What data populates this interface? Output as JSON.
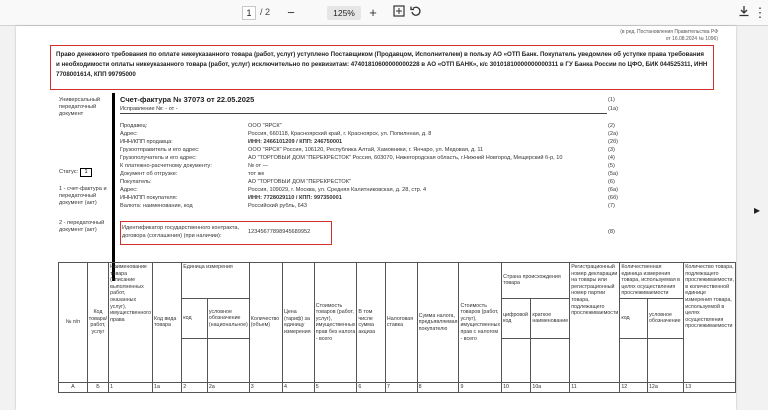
{
  "viewer": {
    "page_current": "1",
    "page_separator": "/",
    "page_total": "2",
    "zoom": "125%",
    "icons": [
      "minus-icon",
      "plus-icon",
      "fit-page-icon",
      "rotate-icon",
      "download-icon",
      "more-icon"
    ]
  },
  "doc": {
    "top_note": [
      "(в ред. Постановления Правительства РФ",
      "от 16.08.2024 № 1096)"
    ],
    "notice": "Право денежного требования по оплате никеуказанного товара (работ, услуг) уступлено Поставщиком (Продавцом, Исполнителем) в пользу АО «ОТП Банк. Покупатель уведомлен об уступке права требования и необходимости оплаты никеуказанного товара (работ, услуг) исключительно по реквизитам: 47401810600000000228 в АО «ОТП БАНК», к/с 30101810000000000311 в ГУ Банка России по ЦФО, БИК 044525311, ИНН 7708001614, КПП 99795000",
    "left_caption_top": "Универсальный передаточный документ",
    "status_label": "Статус:",
    "status_value": "1",
    "left_caption_status1": "1 - счет-фактура и передаточный документ (акт)",
    "left_caption_status2": "2 - передаточный документ (акт)",
    "invoice_title": "Счет-фактура № 37073  от 22.05.2025",
    "invoice_title_num": "(1)",
    "invoice_fix": "Исправление №: - от -",
    "invoice_fix_num": "(1а)",
    "fields": [
      {
        "label": "Продавец:",
        "value": "ООО \"ЯРСК\"",
        "num": "(2)"
      },
      {
        "label": "Адрес:",
        "value": "Россия, 660118, Красноярский край, г. Красноярск, ул. Попилнная, д. 8",
        "num": "(2а)"
      },
      {
        "label": "ИНН/КПП продавца:",
        "value": "ИНН: 2466101209 / КПП: 246750001",
        "num": "(2б)"
      },
      {
        "label": "Грузоотправитель и его адрес:",
        "value": "ООО \"ЯРСК\" Россия, 106120, Республика Алтай, Хамовники, г. Янчаро, ул. Медовая, д. 11",
        "num": "(3)"
      },
      {
        "label": "Грузополучатель и его адрес:",
        "value": "АО \"ТОРГОВЫЙ ДОМ \"ПЕРЕКРЕСТОК\" Россия, 603070, Нижегородская область, г.Нижний Новгород, Мещерский б-р, 10",
        "num": "(4)"
      },
      {
        "label": "К платежно-расчетному документу:",
        "value": "№   от  —",
        "num": "(5)"
      },
      {
        "label": "Документ об отгрузке:",
        "value": "тот же",
        "num": "(5а)"
      },
      {
        "label": "Покупатель:",
        "value": "АО \"ТОРГОВЫЙ ДОМ \"ПЕРЕКРЕСТОК\"",
        "num": "(6)"
      },
      {
        "label": "Адрес:",
        "value": "Россия, 109029, г. Москва, ул. Средняя Калитниковская, д. 28, стр. 4",
        "num": "(6а)"
      },
      {
        "label": "ИНН/КПП покупателя:",
        "value": "ИНН: 7728029110 / КПП: 997350001",
        "num": "(6б)"
      },
      {
        "label": "Валюта: наименование, код",
        "value": "Российский рубль, 643",
        "num": "(7)"
      }
    ],
    "gov_label": "Идентификатор государственного контракта, договора (соглашения) (при наличии):",
    "gov_value": "12345677898945689952",
    "gov_num": "(8)"
  },
  "table": {
    "h_num": "№ п/п",
    "h_code": "Код товара/ работ, услуг",
    "h_name": "Наименование товара (описание выполненных работ, оказанных услуг), имущественного права",
    "h_kind": "Код вида товара",
    "h_unit": "Единица измерения",
    "h_unit_code": "код",
    "h_unit_name": "условное обозначение (национальное)",
    "h_qty": "Количество (объем)",
    "h_price": "Цена (тариф) за единицу измерения",
    "h_cost_notax": "Стоимость товаров (работ, услуг), имущественных прав без налога - всего",
    "h_excise": "В том числе сумма акциза",
    "h_rate": "Налоговая ставка",
    "h_tax": "Сумма налога, предъявляемая покупателю",
    "h_cost_tax": "Стоимость товаров (работ, услуг), имущественных прав с налогом - всего",
    "h_country": "Страна происхождения товара",
    "h_country_code": "цифровой код",
    "h_country_name": "краткое наименование",
    "h_customs": "Регистрационный номер декларации на товары или регистрационный номер партии товара, подлежащего прослеживаемости",
    "h_trace_unit": "Количественная единица измерения товара, используемая в целях осуществления прослеживаемости",
    "h_trace_code": "код",
    "h_trace_name": "условное обозначение",
    "h_trace_qty": "Количество товара, подлежащего прослеживаемости, в количественной единице измерения товара, используемой в целях осуществления прослеживаемости",
    "idx": [
      "А",
      "Б",
      "1",
      "1а",
      "2",
      "2а",
      "3",
      "4",
      "5",
      "6",
      "7",
      "8",
      "9",
      "10",
      "10а",
      "11",
      "12",
      "12а",
      "13"
    ]
  }
}
